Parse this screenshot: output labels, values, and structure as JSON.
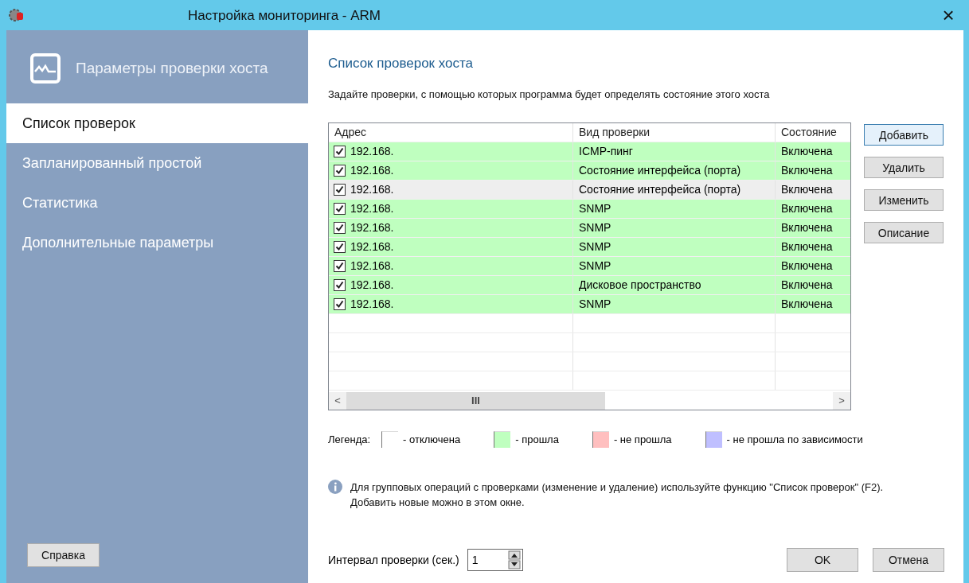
{
  "window": {
    "title": "Настройка мониторинга - ARM",
    "close": "×"
  },
  "sidebar": {
    "title": "Параметры проверки хоста",
    "items": [
      {
        "label": "Список проверок",
        "selected": true
      },
      {
        "label": "Запланированный простой",
        "selected": false
      },
      {
        "label": "Статистика",
        "selected": false
      },
      {
        "label": "Дополнительные параметры",
        "selected": false
      }
    ],
    "help_button": "Справка"
  },
  "content": {
    "title": "Список проверок хоста",
    "description": "Задайте проверки, с помощью которых программа будет определять состояние этого хоста"
  },
  "table": {
    "columns": [
      "Адрес",
      "Вид проверки",
      "Состояние"
    ],
    "rows": [
      {
        "checked": true,
        "address": "192.168.",
        "type": "ICMP-пинг",
        "state": "Включена",
        "color": "#bfffbf",
        "selected": false
      },
      {
        "checked": true,
        "address": "192.168.",
        "type": "Состояние интерфейса (порта)",
        "state": "Включена",
        "color": "#bfffbf",
        "selected": false
      },
      {
        "checked": true,
        "address": "192.168.",
        "type": "Состояние интерфейса (порта)",
        "state": "Включена",
        "selected": true
      },
      {
        "checked": true,
        "address": "192.168.",
        "type": "SNMP",
        "state": "Включена",
        "color": "#bfffbf",
        "selected": false
      },
      {
        "checked": true,
        "address": "192.168.",
        "type": "SNMP",
        "state": "Включена",
        "color": "#bfffbf",
        "selected": false
      },
      {
        "checked": true,
        "address": "192.168.",
        "type": "SNMP",
        "state": "Включена",
        "color": "#bfffbf",
        "selected": false
      },
      {
        "checked": true,
        "address": "192.168.",
        "type": "SNMP",
        "state": "Включена",
        "color": "#bfffbf",
        "selected": false
      },
      {
        "checked": true,
        "address": "192.168.",
        "type": "Дисковое пространство",
        "state": "Включена",
        "color": "#bfffbf",
        "selected": false
      },
      {
        "checked": true,
        "address": "192.168.",
        "type": "SNMP",
        "state": "Включена",
        "color": "#bfffbf",
        "selected": false
      }
    ],
    "scroll_left": "<",
    "scroll_thumb": "III",
    "scroll_right": ">"
  },
  "side_buttons": [
    "Добавить",
    "Удалить",
    "Изменить",
    "Описание"
  ],
  "legend": {
    "label": "Легенда:",
    "items": [
      {
        "label": "- отключена",
        "color": "#ffffff"
      },
      {
        "label": "- прошла",
        "color": "#bfffbf"
      },
      {
        "label": "- не прошла",
        "color": "#ffbfbf"
      },
      {
        "label": "- не прошла по зависимости",
        "color": "#bfbfff"
      }
    ]
  },
  "info": "Для групповых операций с проверками (изменение и удаление) используйте функцию \"Список проверок\" (F2). Добавить новые можно в этом окне.",
  "interval": {
    "label": "Интервал проверки (сек.)",
    "value": "1"
  },
  "buttons": [
    "OK",
    "Отмена"
  ]
}
